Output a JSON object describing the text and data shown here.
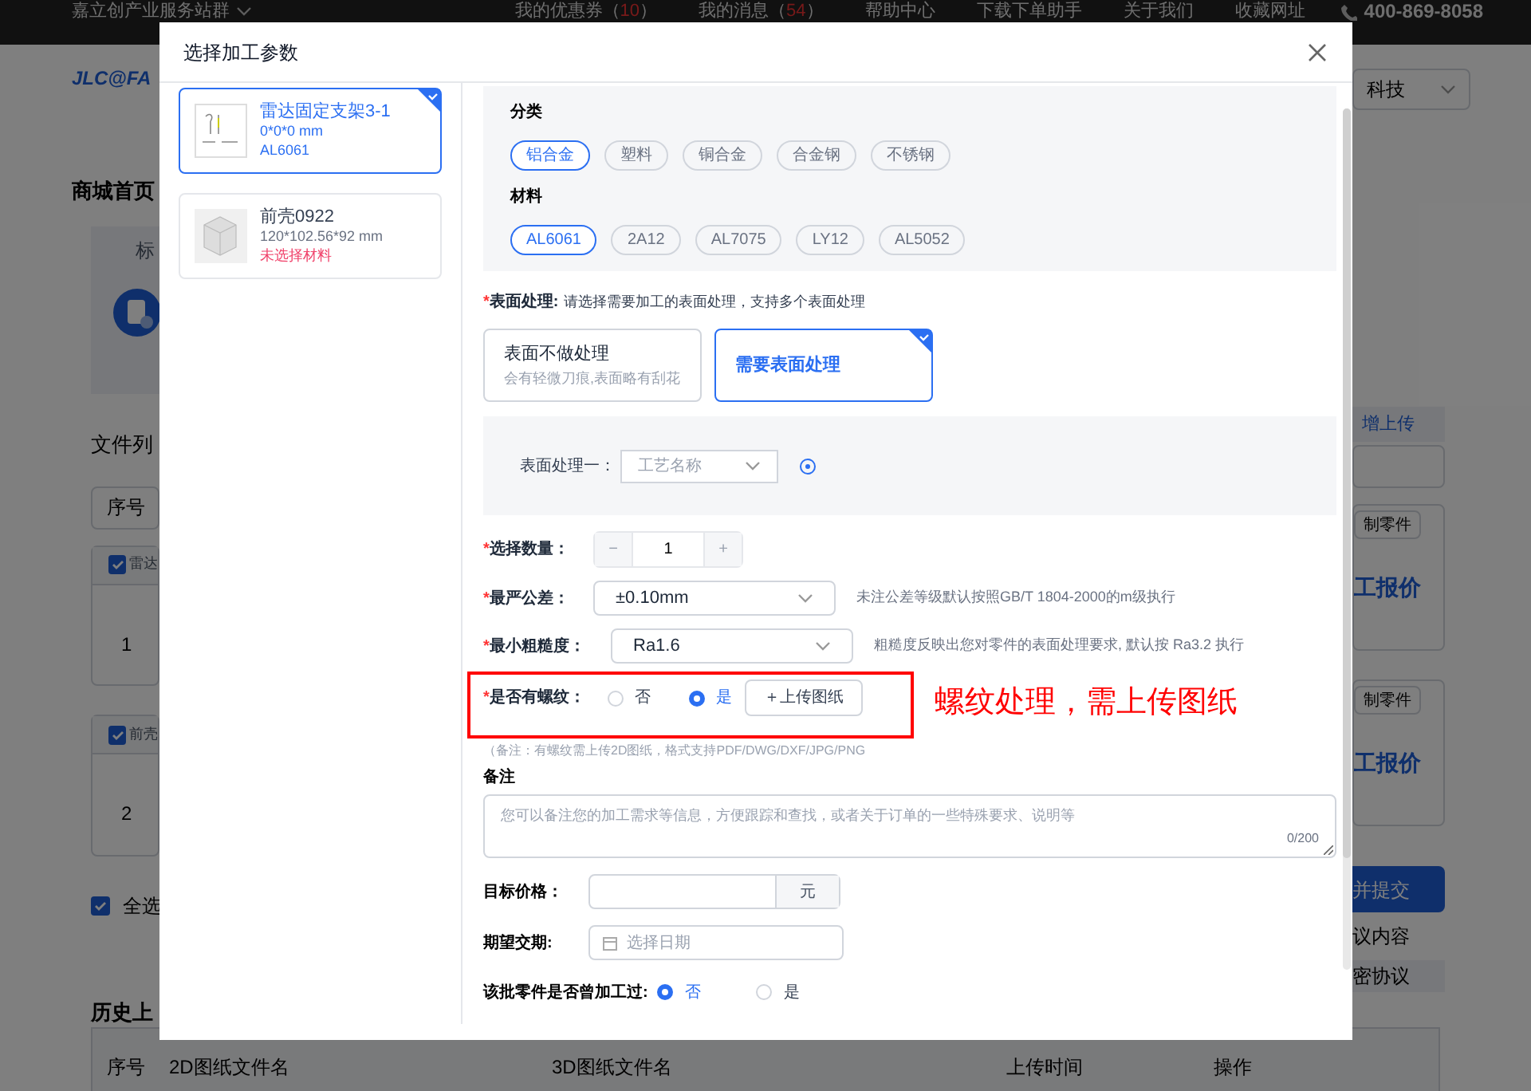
{
  "topbar": {
    "site_menu": "嘉立创产业服务站群",
    "links": [
      "我的优惠券（10）",
      "我的消息（54）",
      "帮助中心",
      "下载下单助手",
      "关于我们",
      "收藏网址"
    ],
    "phone": "400-869-8058"
  },
  "background": {
    "logo": "JLC@FA",
    "nav": "商城首页",
    "tab": "标",
    "file_list": "文件列",
    "table_header": "序号",
    "rows": [
      {
        "name": "雷达",
        "index": "1",
        "checked": true,
        "action": "制零件",
        "quote": "工报价"
      },
      {
        "name": "前壳",
        "index": "2",
        "checked": true,
        "action": "制零件",
        "quote": "工报价"
      }
    ],
    "select_all": {
      "label": "全选",
      "checked": true
    },
    "history": "历史上",
    "company": "科技",
    "upload_link": "增上传",
    "submit": "并提交",
    "agreement_1": "议内容",
    "agreement_2": "密协议",
    "history_columns": [
      "序号",
      "2D图纸文件名",
      "3D图纸文件名",
      "上传时间",
      "操作"
    ]
  },
  "modal": {
    "title": "选择加工参数",
    "parts": [
      {
        "name": "雷达固定支架3-1",
        "size": "0*0*0 mm",
        "material": "AL6061",
        "warning": false,
        "selected": true
      },
      {
        "name": "前壳0922",
        "size": "120*102.56*92 mm",
        "material": "未选择材料",
        "warning": true,
        "selected": false
      }
    ],
    "category": {
      "label": "分类",
      "options": [
        {
          "label": "铝合金",
          "selected": true
        },
        {
          "label": "塑料",
          "selected": false
        },
        {
          "label": "铜合金",
          "selected": false
        },
        {
          "label": "合金钢",
          "selected": false
        },
        {
          "label": "不锈钢",
          "selected": false
        }
      ]
    },
    "material": {
      "label": "材料",
      "options": [
        {
          "label": "AL6061",
          "selected": true
        },
        {
          "label": "2A12",
          "selected": false
        },
        {
          "label": "AL7075",
          "selected": false
        },
        {
          "label": "LY12",
          "selected": false
        },
        {
          "label": "AL5052",
          "selected": false
        }
      ]
    },
    "surface": {
      "mark": "*",
      "label": "表面处理:",
      "hint": "请选择需要加工的表面处理，支持多个表面处理",
      "options": [
        {
          "title": "表面不做处理",
          "desc": "会有轻微刀痕,表面略有刮花",
          "selected": false
        },
        {
          "title": "需要表面处理",
          "selected": true
        }
      ],
      "process_label": "表面处理一：",
      "process_placeholder": "工艺名称"
    },
    "quantity": {
      "mark": "*",
      "label": "选择数量：",
      "minus": "−",
      "value": "1",
      "plus": "+"
    },
    "tolerance": {
      "mark": "*",
      "label": "最严公差：",
      "value": "±0.10mm",
      "note": "未注公差等级默认按照GB/T 1804-2000的m级执行"
    },
    "roughness": {
      "mark": "*",
      "label": "最小粗糙度：",
      "value": "Ra1.6",
      "note": "粗糙度反映出您对零件的表面处理要求, 默认按 Ra3.2 执行"
    },
    "thread": {
      "mark": "*",
      "label": "是否有螺纹：",
      "options": [
        {
          "label": "否",
          "selected": false
        },
        {
          "label": "是",
          "selected": true
        }
      ],
      "upload": "＋上传图纸",
      "note": "（备注：有螺纹需上传2D图纸，格式支持PDF/DWG/DXF/JPG/PNG"
    },
    "remark": {
      "label": "备注",
      "placeholder": "您可以备注您的加工需求等信息，方便跟踪和查找，或者关于订单的一些特殊要求、说明等",
      "counter": "0/200"
    },
    "price": {
      "label": "目标价格：",
      "unit": "元"
    },
    "delivery": {
      "label": "期望交期:",
      "placeholder": "选择日期"
    },
    "processed": {
      "label": "该批零件是否曾加工过:",
      "options": [
        {
          "label": "否",
          "selected": true
        },
        {
          "label": "是",
          "selected": false
        }
      ]
    }
  },
  "annotation": {
    "text": "螺纹处理，需上传图纸"
  }
}
